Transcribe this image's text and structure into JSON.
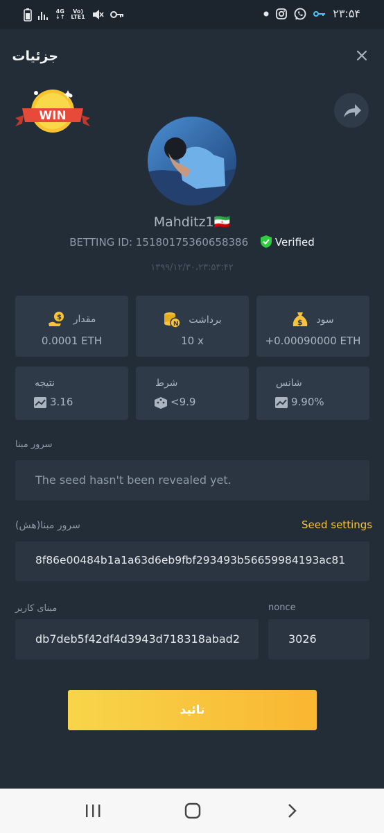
{
  "status_bar": {
    "network_label_top": "4G",
    "network_label_bottom": "LTE1",
    "volte_label": "Vo)",
    "time": "۲۳:۵۴",
    "icons": [
      "battery-icon",
      "signal-icon",
      "mute-icon",
      "key-icon",
      "dot-icon",
      "instagram-icon",
      "whatsapp-icon",
      "vpn-key-icon"
    ]
  },
  "header": {
    "title": "جزئیات",
    "close_icon": "close-icon"
  },
  "badge": {
    "text": "WIN"
  },
  "profile": {
    "username": "Mahditz1🇮🇷",
    "betting_id": "BETTING ID: 15180175360658386",
    "verified_label": "Verified",
    "date": "۱۳۹۹/۱۲/۳۰،۲۳:۵۳:۴۲"
  },
  "stats": {
    "profit": {
      "label": "سود",
      "value": "+0.00090000 ETH",
      "icon": "money-bag-icon"
    },
    "payout": {
      "label": "برداشت",
      "value": "10 x",
      "icon": "coins-icon"
    },
    "amount": {
      "label": "مقدار",
      "value": "0.0001 ETH",
      "icon": "hand-coin-icon"
    },
    "chance": {
      "label": "شانس",
      "value": "9.90%"
    },
    "condition": {
      "label": "شرط",
      "value": "<9.9"
    },
    "result": {
      "label": "نتیجه",
      "value": "3.16"
    }
  },
  "seeds": {
    "server_seed_label": "سرور مبنا",
    "server_seed_value": "The seed hasn't been revealed yet.",
    "hashed_label": "سرور مبنا(هش)",
    "seed_settings_label": "Seed settings",
    "hashed_value": "8f86e00484b1a1a63d6eb9fbf293493b56659984193ac81",
    "client_seed_label": "مبنای کاربر",
    "client_seed_value": "db7deb5f42df4d3943d718318abad2",
    "nonce_label": "nonce",
    "nonce_value": "3026"
  },
  "confirm_button": {
    "label": "تائید"
  },
  "colors": {
    "background": "#232d38",
    "card": "#2e3a47",
    "accent": "#f6c33b",
    "verified": "#2ecc40"
  }
}
